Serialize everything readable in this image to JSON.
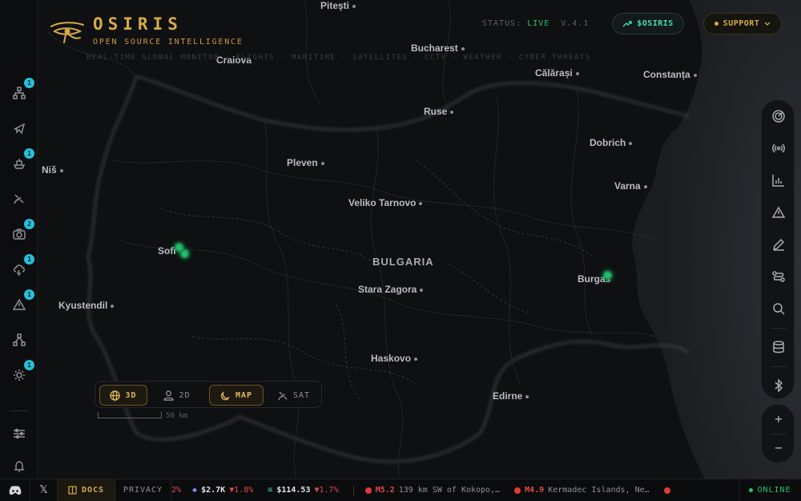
{
  "app": {
    "title": "OSIRIS",
    "subtitle": "OPEN SOURCE INTELLIGENCE",
    "categories": "REAL-TIME GLOBAL MONITOR · FLIGHTS · MARITIME · SATELLITES · CCTV · WEATHER · CYBER THREATS",
    "status_label": "STATUS:",
    "status_value": "LIVE",
    "version": "V.4.1",
    "token_button": "$OSIRIS",
    "support_button": "SUPPORT"
  },
  "colors": {
    "accent_gold": "#d6aa48",
    "live_green": "#25c26d",
    "badge_cyan": "#24c1da",
    "alert_red": "#e24a4a"
  },
  "left_sidebar": {
    "items": [
      {
        "icon": "network-icon",
        "badge": "1"
      },
      {
        "icon": "plane-icon",
        "badge": ""
      },
      {
        "icon": "ship-icon",
        "badge": "1"
      },
      {
        "icon": "satellite-icon",
        "badge": ""
      },
      {
        "icon": "camera-icon",
        "badge": "2"
      },
      {
        "icon": "storm-icon",
        "badge": "1"
      },
      {
        "icon": "warning-icon",
        "badge": "1"
      },
      {
        "icon": "hierarchy-icon",
        "badge": ""
      },
      {
        "icon": "sun-icon",
        "badge": "1"
      },
      {
        "icon": "sliders-icon",
        "badge": ""
      },
      {
        "icon": "bell-icon",
        "badge": ""
      }
    ]
  },
  "right_sidebar": {
    "items": [
      "radar-icon",
      "broadcast-icon",
      "chart-icon",
      "alert-icon",
      "pen-icon",
      "route-icon",
      "search-icon",
      "database-icon",
      "bluetooth-icon"
    ],
    "zoom_in": "+",
    "zoom_out": "−"
  },
  "map": {
    "country_label": "BULGARIA",
    "cities": [
      {
        "name": "Pitești"
      },
      {
        "name": "Bucharest"
      },
      {
        "name": "Craiova"
      },
      {
        "name": "Călărași"
      },
      {
        "name": "Constanța"
      },
      {
        "name": "Ruse"
      },
      {
        "name": "Dobrich"
      },
      {
        "name": "Niš"
      },
      {
        "name": "Pleven"
      },
      {
        "name": "Varna"
      },
      {
        "name": "Veliko Tarnovo"
      },
      {
        "name": "Sofi"
      },
      {
        "name": "Burgas"
      },
      {
        "name": "Kyustendil"
      },
      {
        "name": "Stara Zagora"
      },
      {
        "name": "Haskovo"
      },
      {
        "name": "Edirne"
      }
    ]
  },
  "view_mode": {
    "options": [
      {
        "label": "3D",
        "active": true
      },
      {
        "label": "2D",
        "active": false
      },
      {
        "label": "MAP",
        "active": true
      },
      {
        "label": "SAT",
        "active": false
      }
    ],
    "scale": "50 km"
  },
  "bottom_bar": {
    "docs": "DOCS",
    "privacy": "PRIVACY",
    "ticker": [
      {
        "symbol": "ETH",
        "price": "$2.7K",
        "change": "▼1.8%"
      },
      {
        "symbol": "SOL",
        "price": "$114.53",
        "change": "▼1.7%"
      }
    ],
    "quakes": [
      {
        "mag": "M5.2",
        "loc": "139 km SW of Kokopo,…"
      },
      {
        "mag": "M4.9",
        "loc": "Kermadec Islands, Ne…"
      }
    ],
    "ticker_partial": "2%",
    "online": "ONLINE"
  }
}
